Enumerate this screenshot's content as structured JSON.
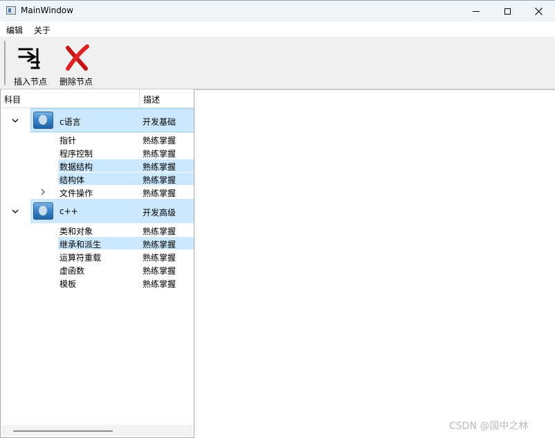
{
  "window": {
    "title": "MainWindow"
  },
  "menu": {
    "items": [
      "编辑",
      "关于"
    ]
  },
  "toolbar": {
    "insert_label": "插入节点",
    "delete_label": "删除节点"
  },
  "tree": {
    "headers": [
      "科目",
      "描述"
    ],
    "categories": [
      {
        "name": "c语言",
        "desc": "开发基础",
        "expanded": true,
        "children": [
          {
            "name": "指针",
            "desc": "熟练掌握",
            "selected": false
          },
          {
            "name": "程序控制",
            "desc": "熟练掌握",
            "selected": false
          },
          {
            "name": "数据结构",
            "desc": "熟练掌握",
            "selected": true
          },
          {
            "name": "结构体",
            "desc": "熟练掌握",
            "selected": true
          },
          {
            "name": "文件操作",
            "desc": "熟练掌握",
            "selected": false,
            "has_children": true
          }
        ]
      },
      {
        "name": "c++",
        "desc": "开发高级",
        "expanded": true,
        "children": [
          {
            "name": "类和对象",
            "desc": "熟练掌握",
            "selected": false
          },
          {
            "name": "继承和派生",
            "desc": "熟练掌握",
            "selected": true
          },
          {
            "name": "运算符重载",
            "desc": "熟练掌握",
            "selected": false
          },
          {
            "name": "虚函数",
            "desc": "熟练掌握",
            "selected": false
          },
          {
            "name": "模板",
            "desc": "熟练掌握",
            "selected": false
          }
        ]
      }
    ]
  },
  "watermark": "CSDN @国中之林",
  "colors": {
    "selection": "#cce8ff",
    "selection_border": "#99d1ff",
    "delete_icon": "#d01818"
  },
  "icons": {
    "insert": "indent-arrow-icon",
    "delete": "red-x-icon",
    "category": "folder-image-icon"
  }
}
